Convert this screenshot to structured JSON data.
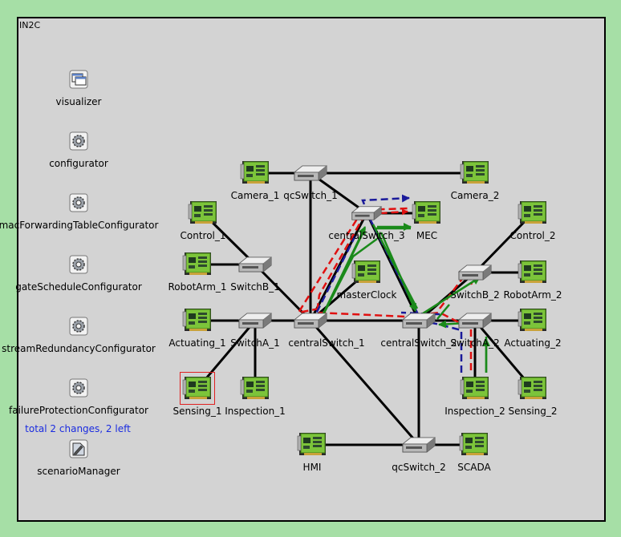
{
  "network": {
    "name": "IN2C"
  },
  "status_text": "total 2 changes, 2 left",
  "colors": {
    "background": "#a6dfa6",
    "canvas": "#d3d3d3",
    "stream_red": "#e01010",
    "stream_blue": "#1a1a9a",
    "stream_green": "#1a8a1a",
    "status_text": "#1a2be0"
  },
  "modules": {
    "visualizer": "visualizer",
    "configurator": "configurator",
    "macForwardingTableConfigurator": "macForwardingTableConfigurator",
    "gateScheduleConfigurator": "gateScheduleConfigurator",
    "streamRedundancyConfigurator": "streamRedundancyConfigurator",
    "failureProtectionConfigurator": "failureProtectionConfigurator",
    "scenarioManager": "scenarioManager"
  },
  "nodes": {
    "camera1": "Camera_1",
    "qcSwitch1": "qcSwitch_1",
    "camera2": "Camera_2",
    "centralSwitch3": "centralSwitch_3",
    "mec": "MEC",
    "control1": "Control_1",
    "control2": "Control_2",
    "robotArm1": "RobotArm_1",
    "switchB1": "SwitchB_1",
    "masterClock": "masterClock",
    "switchB2": "SwitchB_2",
    "robotArm2": "RobotArm_2",
    "actuating1": "Actuating_1",
    "switchA1": "SwitchA_1",
    "centralSwitch1": "centralSwitch_1",
    "centralSwitch2": "centralSwitch_2",
    "switchA2": "SwitchA_2",
    "actuating2": "Actuating_2",
    "sensing1": "Sensing_1",
    "inspection1": "Inspection_1",
    "inspection2": "Inspection_2",
    "sensing2": "Sensing_2",
    "hmi": "HMI",
    "qcSwitch2": "qcSwitch_2",
    "scada": "SCADA"
  }
}
